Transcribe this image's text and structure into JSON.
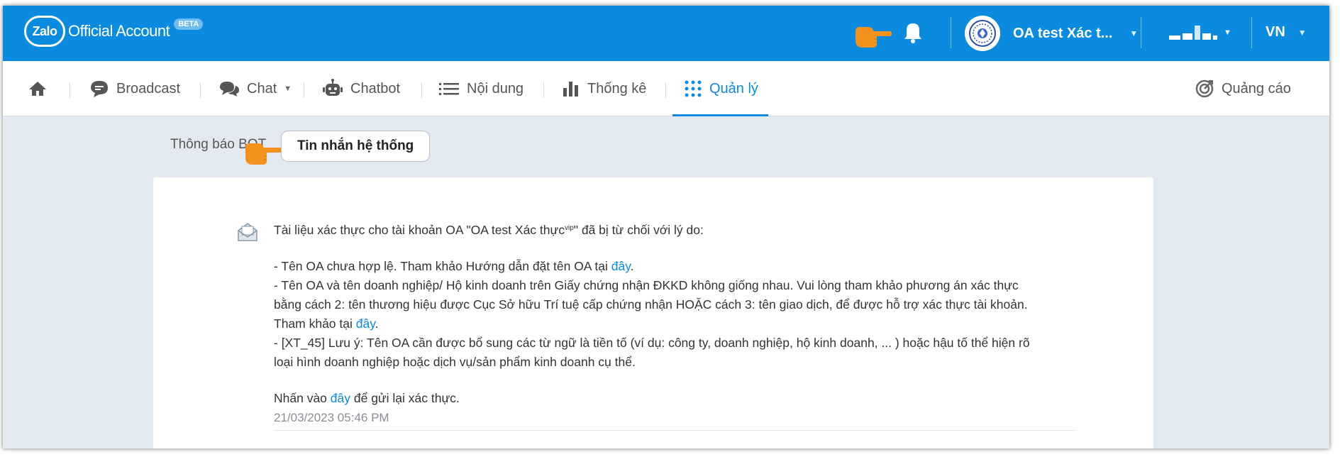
{
  "brand": {
    "logo_text": "Zalo",
    "product": "Official Account",
    "badge": "BETA"
  },
  "topbar": {
    "account_name": "OA test Xác t...",
    "language": "VN"
  },
  "nav": {
    "items": [
      {
        "label": "Broadcast"
      },
      {
        "label": "Chat"
      },
      {
        "label": "Chatbot"
      },
      {
        "label": "Nội dung"
      },
      {
        "label": "Thống kê"
      },
      {
        "label": "Quản lý"
      }
    ],
    "ads_label": "Quảng cáo"
  },
  "tabs": {
    "bot_notice": "Thông báo BOT",
    "system_messages": "Tin nhắn hệ thống"
  },
  "message": {
    "intro_pre": "Tài liệu xác thực cho tài khoản OA \"OA test Xác thực",
    "intro_sup": "vip",
    "intro_post": "\" đã bị từ chối với lý do:",
    "r1": "- Tên OA chưa hợp lệ. Tham khảo Hướng dẫn đặt tên OA tại ",
    "link_text": "đây",
    "r1_end": ".",
    "r2_l1": "- Tên OA và tên doanh nghiệp/ Hộ kinh doanh trên Giấy chứng nhận ĐKKD không giống nhau. Vui lòng tham khảo phương án xác thực",
    "r2_l2": "bằng cách 2: tên thương hiệu được Cục Sở hữu Trí tuệ cấp chứng nhận HOẶC cách 3: tên giao dịch, để được hỗ trợ xác thực tài khoản.",
    "r2_l3": "Tham khảo tại ",
    "r3_l1": "- [XT_45] Lưu ý: Tên OA cần được bổ sung các từ ngữ là tiền tố (ví dụ: công ty, doanh nghiệp, hộ kinh doanh, ... ) hoặc hậu tố thể hiện rõ",
    "r3_l2": "loại hình doanh nghiệp hoặc dịch vụ/sản phẩm kinh doanh cụ thể.",
    "cta_pre": "Nhấn vào ",
    "cta_post": " để gửi lại xác thực.",
    "timestamp": "21/03/2023 05:46 PM"
  },
  "colors": {
    "brand_blue": "#0a8bdf",
    "pointer_orange": "#f5921e",
    "background": "#e3e9f0"
  },
  "icons": [
    "home-icon",
    "broadcast-icon",
    "chat-icon",
    "chatbot-icon",
    "list-icon",
    "bar-chart-icon",
    "grid-icon",
    "target-icon",
    "bell-icon",
    "envelope-icon",
    "hand-pointer-icon"
  ]
}
